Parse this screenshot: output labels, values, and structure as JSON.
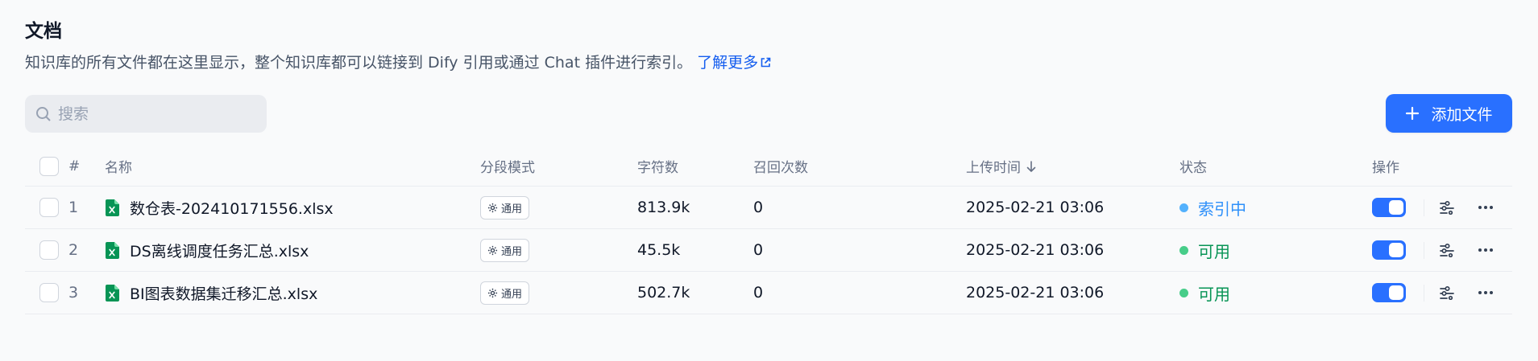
{
  "header": {
    "title": "文档",
    "description": "知识库的所有文件都在这里显示，整个知识库都可以链接到 Dify 引用或通过 Chat 插件进行索引。",
    "learn_more": "了解更多"
  },
  "search": {
    "placeholder": "搜索",
    "value": ""
  },
  "add_button": {
    "label": "添加文件",
    "icon": "plus-icon"
  },
  "table": {
    "columns": {
      "index": "#",
      "name": "名称",
      "mode": "分段模式",
      "chars": "字符数",
      "recall": "召回次数",
      "upload_time": "上传时间",
      "status": "状态",
      "actions": "操作"
    },
    "rows": [
      {
        "index": "1",
        "name": "数仓表-202410171556.xlsx",
        "mode": "通用",
        "chars": "813.9k",
        "recall": "0",
        "upload_time": "2025-02-21 03:06",
        "status": "索引中",
        "status_color": "#2e90fa",
        "status_dot": "#53b1fd",
        "enabled": true
      },
      {
        "index": "2",
        "name": "DS离线调度任务汇总.xlsx",
        "mode": "通用",
        "chars": "45.5k",
        "recall": "0",
        "upload_time": "2025-02-21 03:06",
        "status": "可用",
        "status_color": "#079455",
        "status_dot": "#47cd89",
        "enabled": true
      },
      {
        "index": "3",
        "name": "BI图表数据集迁移汇总.xlsx",
        "mode": "通用",
        "chars": "502.7k",
        "recall": "0",
        "upload_time": "2025-02-21 03:06",
        "status": "可用",
        "status_color": "#079455",
        "status_dot": "#47cd89",
        "enabled": true
      }
    ]
  },
  "colors": {
    "accent": "#2970ff",
    "excel_green": "#079455"
  }
}
